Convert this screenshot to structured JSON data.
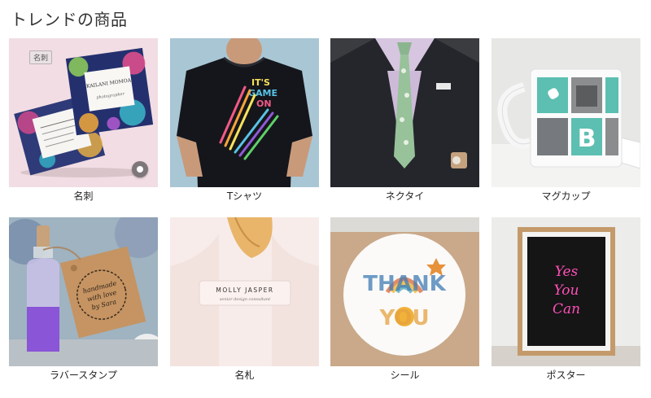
{
  "section": {
    "title": "トレンドの商品"
  },
  "products": [
    {
      "label": "名刺",
      "badge": "名刺",
      "card_name": "KAILANI MOMOA",
      "card_sub": "photographer",
      "icon": "business-card-image"
    },
    {
      "label": "Tシャツ",
      "shirt_text": [
        "IT'S",
        "GAME",
        "ON"
      ],
      "icon": "t-shirt-image"
    },
    {
      "label": "ネクタイ",
      "icon": "necktie-image"
    },
    {
      "label": "マグカップ",
      "mug_letter": "B",
      "icon": "mug-image"
    },
    {
      "label": "ラバースタンプ",
      "tag_text": [
        "handmade",
        "with love",
        "by Sara"
      ],
      "icon": "rubber-stamp-image"
    },
    {
      "label": "名札",
      "tag_name": "MOLLY JASPER",
      "tag_title": "senior design consultant",
      "icon": "name-tag-image"
    },
    {
      "label": "シール",
      "sticker_text": [
        "THANK",
        "YOU"
      ],
      "icon": "sticker-image"
    },
    {
      "label": "ポスター",
      "poster_text": [
        "Yes",
        "You",
        "Can"
      ],
      "icon": "poster-image"
    }
  ],
  "colors": {
    "pink_bg": "#f1dde3",
    "shirt_bg": "#a9c6d4",
    "mug_teal": "#5cbfb1",
    "neon_pink": "#ff4fb8"
  }
}
